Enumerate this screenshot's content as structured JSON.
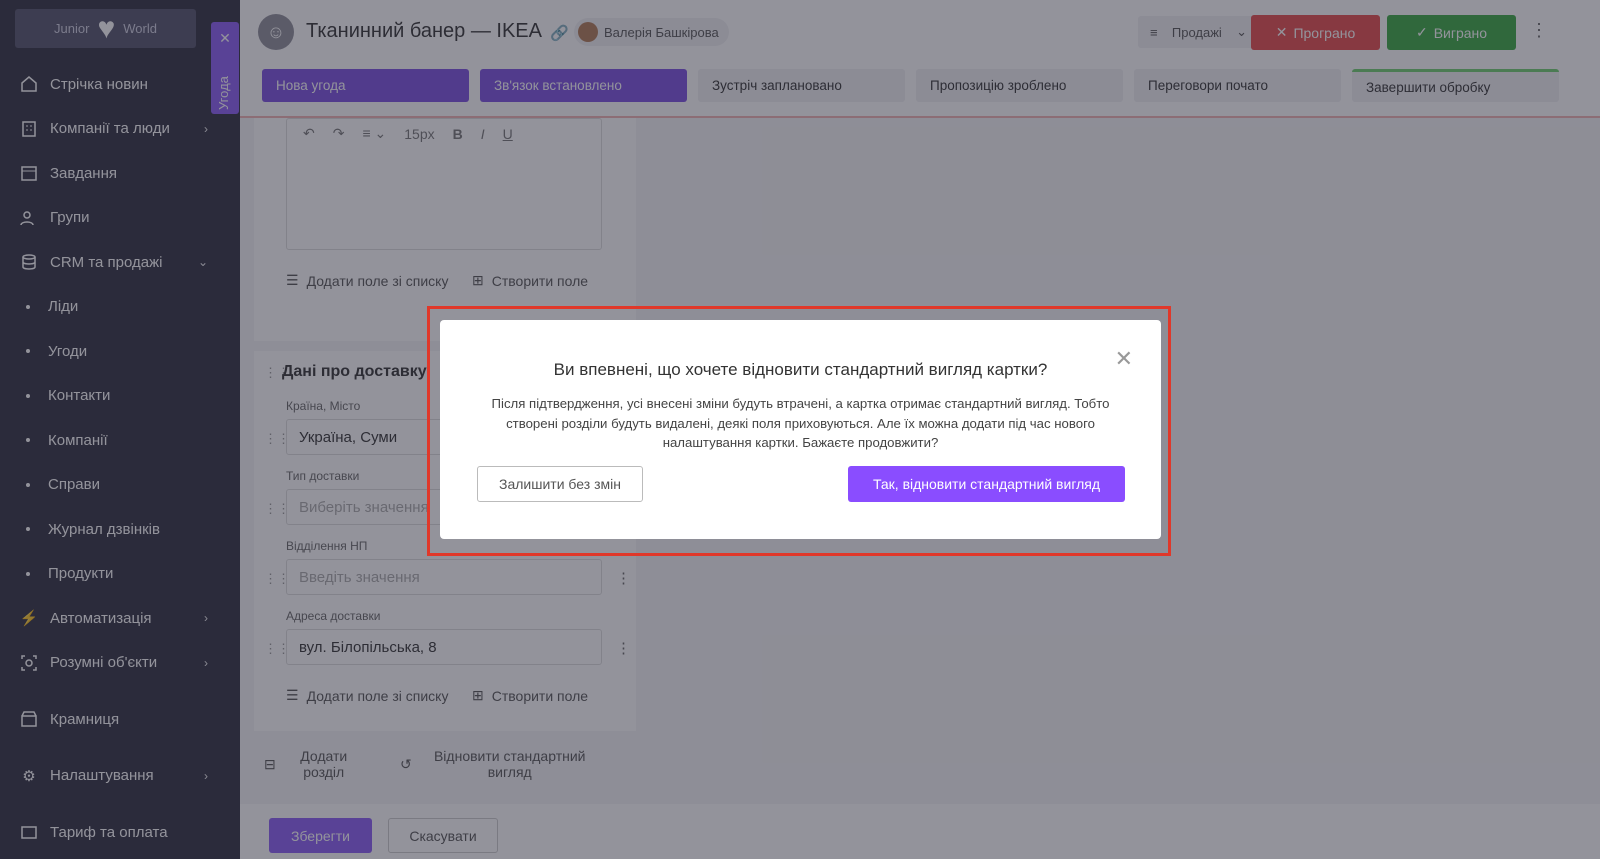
{
  "sidebar": {
    "logo_left": "Junior",
    "logo_right": "World",
    "items": [
      {
        "label": "Стрічка новин"
      },
      {
        "label": "Компанії та люди"
      },
      {
        "label": "Завдання"
      },
      {
        "label": "Групи"
      },
      {
        "label": "CRM та продажі"
      }
    ],
    "sub_items": [
      {
        "label": "Ліди"
      },
      {
        "label": "Угоди"
      },
      {
        "label": "Контакти"
      },
      {
        "label": "Компанії"
      },
      {
        "label": "Справи"
      },
      {
        "label": "Журнал дзвінків"
      },
      {
        "label": "Продукти"
      }
    ],
    "items_bottom": [
      {
        "label": "Автоматизація"
      },
      {
        "label": "Розумні об'єкти"
      },
      {
        "label": "Крамниця"
      },
      {
        "label": "Налаштування"
      },
      {
        "label": "Тариф та оплата"
      }
    ]
  },
  "side_tab": {
    "label": "Угода"
  },
  "header": {
    "title": "Тканинний банер — IKEA",
    "owner": "Валерія Башкірова",
    "pipeline": "Продажі",
    "lost_label": "Програно",
    "won_label": "Виграно",
    "stages": [
      {
        "label": "Нова угода"
      },
      {
        "label": "Зв'язок встановлено"
      },
      {
        "label": "Зустріч заплановано"
      },
      {
        "label": "Пропозицію зроблено"
      },
      {
        "label": "Переговори почато"
      },
      {
        "label": "Завершити обробку"
      }
    ]
  },
  "editor": {
    "font_size": "15px",
    "bold": "B",
    "italic": "I",
    "underline": "U"
  },
  "card1": {
    "add_field_from_list": "Додати поле зі списку",
    "create_field": "Створити поле"
  },
  "delivery": {
    "title": "Дані про доставку",
    "fields": [
      {
        "label": "Країна, Місто",
        "value": "Україна, Суми",
        "placeholder": ""
      },
      {
        "label": "Тип доставки",
        "value": "",
        "placeholder": "Виберіть значення"
      },
      {
        "label": "Відділення НП",
        "value": "",
        "placeholder": "Введіть значення"
      },
      {
        "label": "Адреса доставки",
        "value": "вул. Білопільська, 8",
        "placeholder": ""
      }
    ],
    "add_field_from_list": "Додати поле зі списку",
    "create_field": "Створити поле"
  },
  "bottom_actions": {
    "add_section": "Додати розділ",
    "restore_default": "Відновити стандартний вигляд"
  },
  "footer": {
    "save": "Зберегти",
    "cancel": "Скасувати"
  },
  "modal": {
    "title": "Ви впевнені, що хочете відновити стандартний вигляд картки?",
    "text": "Після підтвердження, усі внесені зміни будуть втрачені, а картка отримає стандартний вигляд. Тобто створені розділи будуть видалені, деякі поля приховуються. Але їх можна додати під час нового налаштування картки. Бажаєте продовжити?",
    "keep": "Залишити без змін",
    "confirm": "Так, відновити стандартний вигляд"
  }
}
